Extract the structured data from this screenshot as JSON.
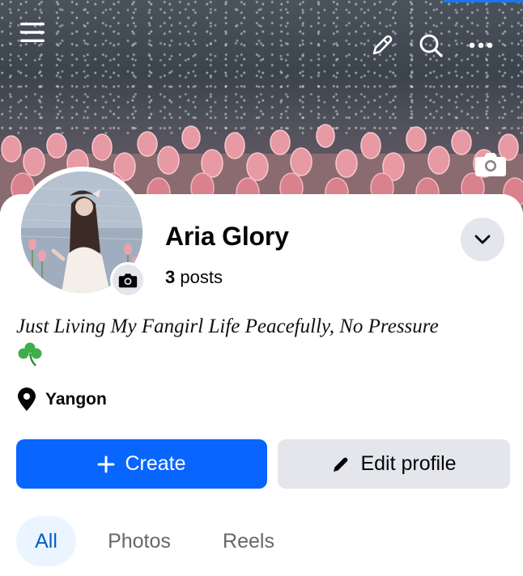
{
  "header": {
    "menu_icon": "hamburger-menu-icon",
    "edit_icon": "pencil-icon",
    "search_icon": "search-icon",
    "more_icon": "more-horizontal-icon",
    "cover_camera_icon": "camera-icon"
  },
  "profile": {
    "name": "Aria Glory",
    "posts_count": "3",
    "posts_label": "posts",
    "bio": "Just Living My Fangirl Life Peacefully, No Pressure",
    "bio_emoji": "shamrock",
    "location_icon": "location-pin-icon",
    "location": "Yangon"
  },
  "actions": {
    "create_label": "Create",
    "edit_profile_label": "Edit profile"
  },
  "tabs": [
    {
      "label": "All",
      "selected": true
    },
    {
      "label": "Photos",
      "selected": false
    },
    {
      "label": "Reels",
      "selected": false
    }
  ],
  "colors": {
    "primary": "#0866ff",
    "secondary_button": "#e4e6eb",
    "selected_tab_bg": "#ebf5ff",
    "selected_tab_text": "#0a5dc2",
    "muted_text": "#65676b"
  }
}
